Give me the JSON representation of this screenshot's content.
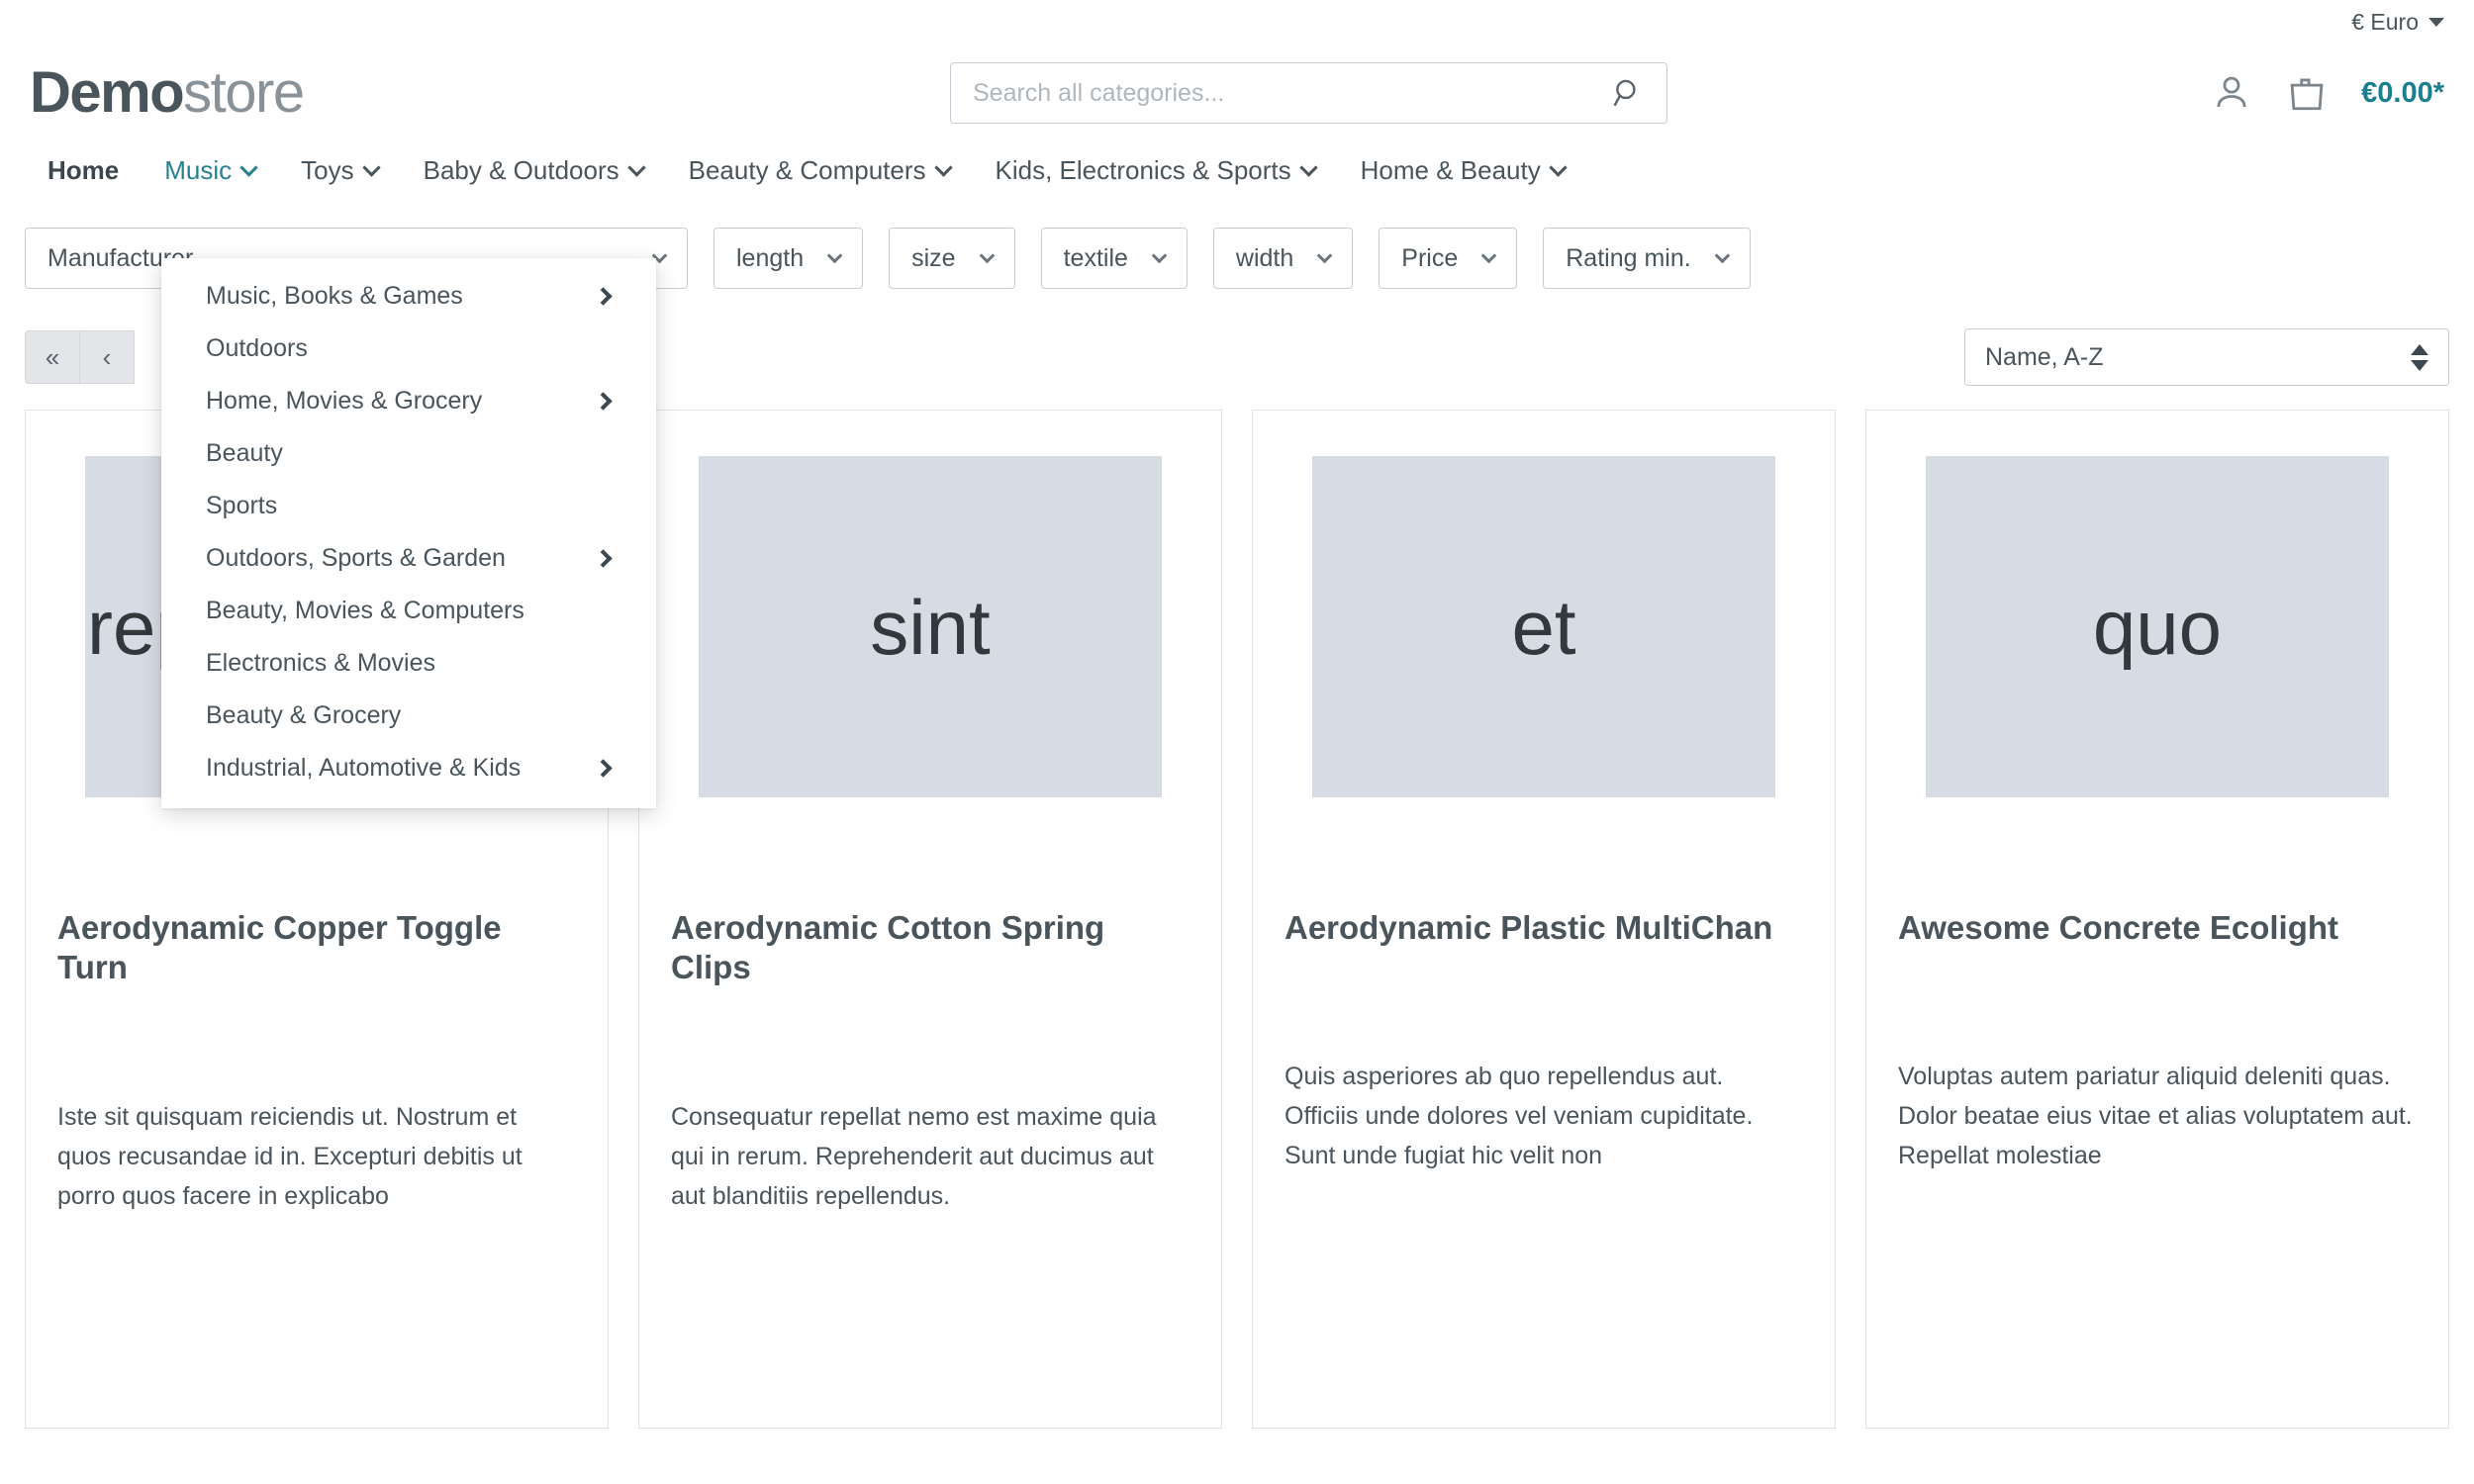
{
  "topbar": {
    "currency_label": "€ Euro"
  },
  "header": {
    "logo_bold": "Demo",
    "logo_light": "store",
    "search_placeholder": "Search all categories...",
    "search_value": "",
    "cart_total": "€0.00*"
  },
  "nav": {
    "items": [
      {
        "label": "Home",
        "has_chevron": false,
        "active": false,
        "bold": true
      },
      {
        "label": "Music",
        "has_chevron": true,
        "active": true,
        "bold": false
      },
      {
        "label": "Toys",
        "has_chevron": true,
        "active": false,
        "bold": false
      },
      {
        "label": "Baby & Outdoors",
        "has_chevron": true,
        "active": false,
        "bold": false
      },
      {
        "label": "Beauty & Computers",
        "has_chevron": true,
        "active": false,
        "bold": false
      },
      {
        "label": "Kids, Electronics & Sports",
        "has_chevron": true,
        "active": false,
        "bold": false
      },
      {
        "label": "Home & Beauty",
        "has_chevron": true,
        "active": false,
        "bold": false
      }
    ]
  },
  "flyout": {
    "items": [
      {
        "label": "Music, Books & Games",
        "has_arrow": true
      },
      {
        "label": "Outdoors",
        "has_arrow": false
      },
      {
        "label": "Home, Movies & Grocery",
        "has_arrow": true
      },
      {
        "label": "Beauty",
        "has_arrow": false
      },
      {
        "label": "Sports",
        "has_arrow": false
      },
      {
        "label": "Outdoors, Sports & Garden",
        "has_arrow": true
      },
      {
        "label": "Beauty, Movies & Computers",
        "has_arrow": false
      },
      {
        "label": "Electronics & Movies",
        "has_arrow": false
      },
      {
        "label": "Beauty & Grocery",
        "has_arrow": false
      },
      {
        "label": "Industrial, Automotive & Kids",
        "has_arrow": true
      }
    ]
  },
  "filters": [
    {
      "label": "Manufacturer"
    },
    {
      "label": "length"
    },
    {
      "label": "size"
    },
    {
      "label": "textile"
    },
    {
      "label": "width"
    },
    {
      "label": "Price"
    },
    {
      "label": "Rating min."
    }
  ],
  "controls": {
    "pagination": [
      {
        "label": "«",
        "name": "first-page"
      },
      {
        "label": "‹",
        "name": "prev-page"
      }
    ],
    "sort_value": "Name, A-Z"
  },
  "products": [
    {
      "image_text": "reprehenderit",
      "title": "Aerodynamic Copper Toggle Turn",
      "description": "Iste sit quisquam reiciendis ut. Nostrum et quos recusandae id in. Excepturi debitis ut porro quos facere in explicabo"
    },
    {
      "image_text": "sint",
      "title": "Aerodynamic Cotton Spring Clips",
      "description": "Consequatur repellat nemo est maxime quia qui in rerum. Reprehenderit aut ducimus aut aut blanditiis repellendus."
    },
    {
      "image_text": "et",
      "title": "Aerodynamic Plastic MultiChan",
      "description": "Quis asperiores ab quo repellendus aut. Officiis unde dolores vel veniam cupiditate. Sunt unde fugiat hic velit non"
    },
    {
      "image_text": "quo",
      "title": "Awesome Concrete Ecolight",
      "description": "Voluptas autem pariatur aliquid deleniti quas. Dolor beatae eius vitae et alias voluptatem aut. Repellat molestiae"
    }
  ],
  "colors": {
    "accent_teal": "#1a7f8e",
    "nav_active": "#25818f",
    "text": "#4a545b",
    "image_placeholder": "#d7dbe3"
  }
}
